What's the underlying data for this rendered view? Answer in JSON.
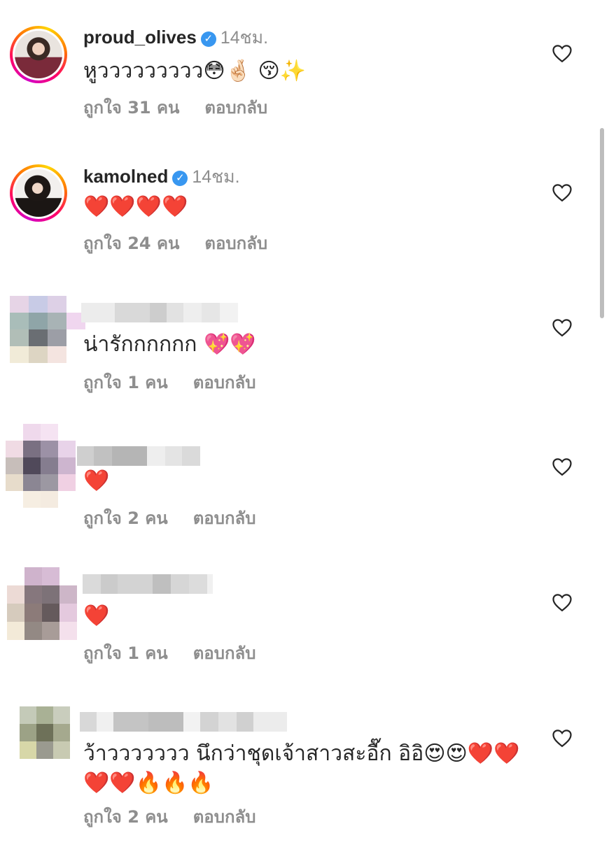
{
  "comments": [
    {
      "username": "proud_olives",
      "verified": true,
      "time": "14ชม.",
      "text": "หูววววววววว😳🤞🏻 😚✨",
      "likes": "ถูกใจ 31 คน",
      "reply": "ตอบกลับ"
    },
    {
      "username": "kamolned",
      "verified": true,
      "time": "14ชม.",
      "text": "❤️❤️❤️❤️",
      "likes": "ถูกใจ 24 คน",
      "reply": "ตอบกลับ"
    },
    {
      "username": "",
      "verified": false,
      "text": "น่ารักกกกกก 💖💖",
      "likes": "ถูกใจ 1 คน",
      "reply": "ตอบกลับ"
    },
    {
      "username": "",
      "verified": false,
      "text": "❤️",
      "likes": "ถูกใจ 2 คน",
      "reply": "ตอบกลับ"
    },
    {
      "username": "",
      "verified": false,
      "text": "❤️",
      "likes": "ถูกใจ 1 คน",
      "reply": "ตอบกลับ"
    },
    {
      "username": "",
      "verified": false,
      "text": "ว้าววววววว นึกว่าชุดเจ้าสาวสะอื๊ก อิอิ😍😍❤️❤️",
      "text2": "❤️❤️🔥🔥🔥",
      "likes": "ถูกใจ 2 คน",
      "reply": "ตอบกลับ"
    }
  ],
  "icons": {
    "like": "heart-outline-icon",
    "verified": "verified-badge-icon"
  },
  "colors": {
    "username": "#262626",
    "meta": "#8e8e8e",
    "verified": "#3897f0"
  }
}
